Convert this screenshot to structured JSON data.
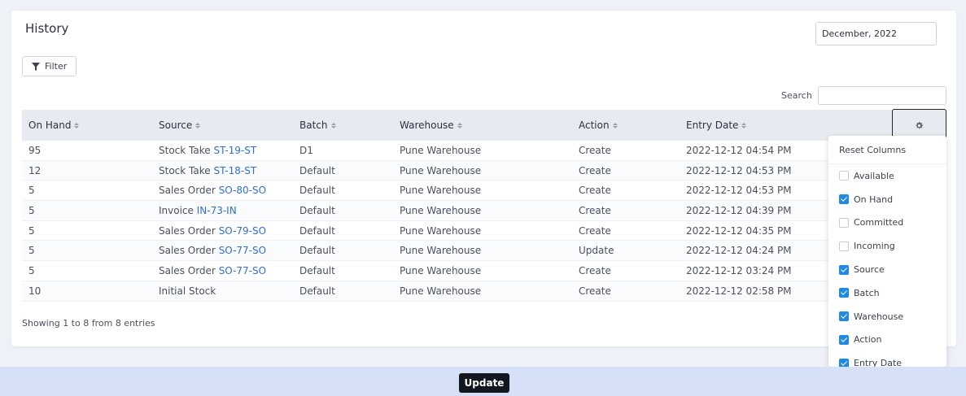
{
  "title": "History",
  "month_field": "December, 2022",
  "filter_label": "Filter",
  "search": {
    "label": "Search",
    "value": ""
  },
  "columns": [
    "On Hand",
    "Source",
    "Batch",
    "Warehouse",
    "Action",
    "Entry Date"
  ],
  "rows": [
    {
      "on_hand": "95",
      "source_type": "Stock Take",
      "source_ref": "ST-19-ST",
      "batch": "D1",
      "warehouse": "Pune Warehouse",
      "action": "Create",
      "entry_date": "2022-12-12 04:54 PM"
    },
    {
      "on_hand": "12",
      "source_type": "Stock Take",
      "source_ref": "ST-18-ST",
      "batch": "Default",
      "warehouse": "Pune Warehouse",
      "action": "Create",
      "entry_date": "2022-12-12 04:53 PM"
    },
    {
      "on_hand": "5",
      "source_type": "Sales Order",
      "source_ref": "SO-80-SO",
      "batch": "Default",
      "warehouse": "Pune Warehouse",
      "action": "Create",
      "entry_date": "2022-12-12 04:53 PM"
    },
    {
      "on_hand": "5",
      "source_type": "Invoice",
      "source_ref": "IN-73-IN",
      "batch": "Default",
      "warehouse": "Pune Warehouse",
      "action": "Create",
      "entry_date": "2022-12-12 04:39 PM"
    },
    {
      "on_hand": "5",
      "source_type": "Sales Order",
      "source_ref": "SO-79-SO",
      "batch": "Default",
      "warehouse": "Pune Warehouse",
      "action": "Create",
      "entry_date": "2022-12-12 04:35 PM"
    },
    {
      "on_hand": "5",
      "source_type": "Sales Order",
      "source_ref": "SO-77-SO",
      "batch": "Default",
      "warehouse": "Pune Warehouse",
      "action": "Update",
      "entry_date": "2022-12-12 04:24 PM"
    },
    {
      "on_hand": "5",
      "source_type": "Sales Order",
      "source_ref": "SO-77-SO",
      "batch": "Default",
      "warehouse": "Pune Warehouse",
      "action": "Create",
      "entry_date": "2022-12-12 03:24 PM"
    },
    {
      "on_hand": "10",
      "source_type": "Initial Stock",
      "source_ref": "",
      "batch": "Default",
      "warehouse": "Pune Warehouse",
      "action": "Create",
      "entry_date": "2022-12-12 02:58 PM"
    }
  ],
  "footer_text": "Showing 1 to 8 from 8 entries",
  "column_menu": {
    "reset_label": "Reset Columns",
    "options": [
      {
        "label": "Available",
        "checked": false
      },
      {
        "label": "On Hand",
        "checked": true
      },
      {
        "label": "Committed",
        "checked": false
      },
      {
        "label": "Incoming",
        "checked": false
      },
      {
        "label": "Source",
        "checked": true
      },
      {
        "label": "Batch",
        "checked": true
      },
      {
        "label": "Warehouse",
        "checked": true
      },
      {
        "label": "Action",
        "checked": true
      },
      {
        "label": "Entry Date",
        "checked": true
      }
    ]
  },
  "update_label": "Update",
  "colors": {
    "link": "#2f6fd6",
    "header_bg": "#e7ebf1",
    "checkbox_on": "#1e8ae6",
    "bottom_bar": "#d6e0f7",
    "update_button": "#12161f"
  },
  "icons": {
    "filter": "filter-icon",
    "gear": "gear-icon"
  }
}
